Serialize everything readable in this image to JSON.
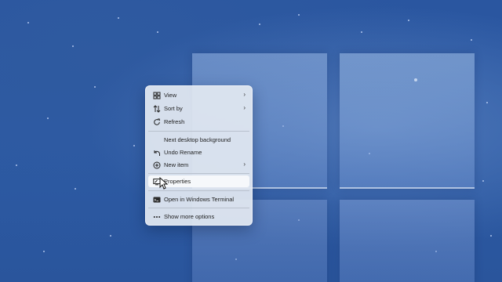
{
  "desktop": {
    "background": "Windows 11 blue bloom wallpaper",
    "accent_color": "#2c5aa4"
  },
  "context_menu": {
    "items": [
      {
        "label": "View",
        "icon": "grid-icon",
        "submenu": true
      },
      {
        "label": "Sort by",
        "icon": "sort-arrows-icon",
        "submenu": true
      },
      {
        "label": "Refresh",
        "icon": "refresh-icon",
        "submenu": false
      },
      {
        "label": "Next desktop background",
        "icon": "",
        "submenu": false
      },
      {
        "label": "Undo Rename",
        "icon": "undo-icon",
        "submenu": false
      },
      {
        "label": "New item",
        "icon": "plus-circle-icon",
        "submenu": true
      },
      {
        "label": "Properties",
        "icon": "display-settings-icon",
        "submenu": false,
        "highlighted": true
      },
      {
        "label": "Open in Windows Terminal",
        "icon": "terminal-icon",
        "submenu": false
      },
      {
        "label": "Show more options",
        "icon": "more-icon",
        "submenu": false
      }
    ],
    "chevron": "›"
  }
}
